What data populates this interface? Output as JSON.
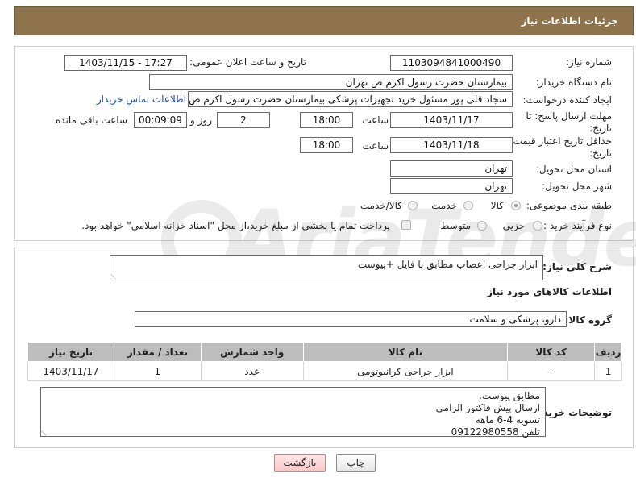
{
  "header": {
    "title": "جزئیات اطلاعات نیاز"
  },
  "fields": {
    "need_number_label": "شماره نیاز:",
    "need_number": "1103094841000490",
    "announce_label": "تاریخ و ساعت اعلان عمومی:",
    "announce_value": "1403/11/15 - 17:27",
    "buyer_label": "نام دستگاه خریدار:",
    "buyer_value": "بیمارستان حضرت رسول اکرم ص  تهران",
    "creator_label": "ایجاد کننده درخواست:",
    "creator_value": "سجاد قلی پور مسئول خرید تجهیزات پزشکی  بیمارستان حضرت رسول اکرم ص",
    "contact_link": "اطلاعات تماس خریدار",
    "reply_deadline_label": "مهلت ارسال پاسخ: تا",
    "reply_deadline_label2": "تاریخ:",
    "reply_date": "1403/11/17",
    "time_label": "ساعت",
    "reply_time": "18:00",
    "days_value": "2",
    "days_label": "روز و",
    "remaining_value": "00:09:09",
    "remaining_label": "ساعت باقی مانده",
    "price_validity_label": "حداقل تاریخ اعتبار قیمت: تا",
    "price_validity_label2": "تاریخ:",
    "price_date": "1403/11/18",
    "price_time": "18:00",
    "province_label": "استان محل تحویل:",
    "province_value": "تهران",
    "city_label": "شهر محل تحویل:",
    "city_value": "تهران",
    "category_label": "طبقه بندی موضوعی:",
    "category_options": [
      "کالا",
      "خدمت",
      "کالا/خدمت"
    ],
    "process_label": "نوع فرآیند خرید :",
    "process_options": [
      "جزیی",
      "متوسط"
    ],
    "payment_note": "پرداخت تمام یا بخشی از مبلغ خرید،از محل \"اسناد خزانه اسلامی\" خواهد بود."
  },
  "details": {
    "general_desc_label": "شرح کلی نیاز:",
    "general_desc": "ابزار جراحی اعصاب مطابق با فایل +پیوست",
    "goods_info_title": "اطلاعات کالاهای مورد نیاز",
    "goods_group_label": "گروه کالا:",
    "goods_group": "دارو، پزشکی و سلامت"
  },
  "table": {
    "headers": [
      "ردیف",
      "کد کالا",
      "نام کالا",
      "واحد شمارش",
      "تعداد / مقدار",
      "تاریخ نیاز"
    ],
    "rows": [
      [
        "1",
        "--",
        "ابزار جراحی کرانیوتومی",
        "عدد",
        "1",
        "1403/11/17"
      ]
    ]
  },
  "buyer_notes": {
    "label": "توضیحات خریدار:",
    "lines": [
      "مطابق پیوست.",
      "ارسال پیش فاکتور الزامی",
      "تسویه 4-6 ماهه",
      "تلفن 09122980558"
    ]
  },
  "buttons": {
    "print": "چاپ",
    "back": "بازگشت"
  },
  "watermark": "AriaTender.neT"
}
